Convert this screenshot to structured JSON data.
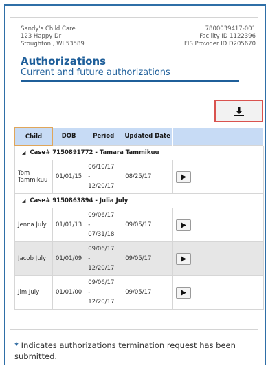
{
  "provider": {
    "name": "Sandy's Child Care",
    "address1": "123 Happy Dr",
    "address2": "Stoughton , WI 53589",
    "phone": "7800039417-001",
    "facility_id": "Facility ID 1122396",
    "fis_provider_id": "FIS Provider ID D205670"
  },
  "page": {
    "title": "Authorizations",
    "subtitle": "Current and future authorizations"
  },
  "download": {
    "icon": "download-icon"
  },
  "table": {
    "headers": [
      "Child",
      "DOB",
      "Period",
      "Updated Date",
      ""
    ],
    "cases": [
      {
        "label": "Case# 7150891772 - Tamara Tammikuu",
        "rows": [
          {
            "child": "Tom Tammikuu",
            "dob": "01/01/15",
            "period_start": "06/10/17",
            "period_sep": "-",
            "period_end": "12/20/17",
            "updated": "08/25/17"
          }
        ]
      },
      {
        "label": "Case# 9150863894 - Julia July",
        "rows": [
          {
            "child": "Jenna July",
            "dob": "01/01/13",
            "period_start": "09/06/17",
            "period_sep": "-",
            "period_end": "07/31/18",
            "updated": "09/05/17"
          },
          {
            "child": "Jacob July",
            "dob": "01/01/09",
            "period_start": "09/06/17",
            "period_sep": "-",
            "period_end": "12/20/17",
            "updated": "09/05/17"
          },
          {
            "child": "Jim July",
            "dob": "01/01/00",
            "period_start": "09/06/17",
            "period_sep": "-",
            "period_end": "12/20/17",
            "updated": "09/05/17"
          }
        ]
      }
    ]
  },
  "footnote": {
    "star": "*",
    "text": " Indicates authorizations termination request has been submitted."
  }
}
